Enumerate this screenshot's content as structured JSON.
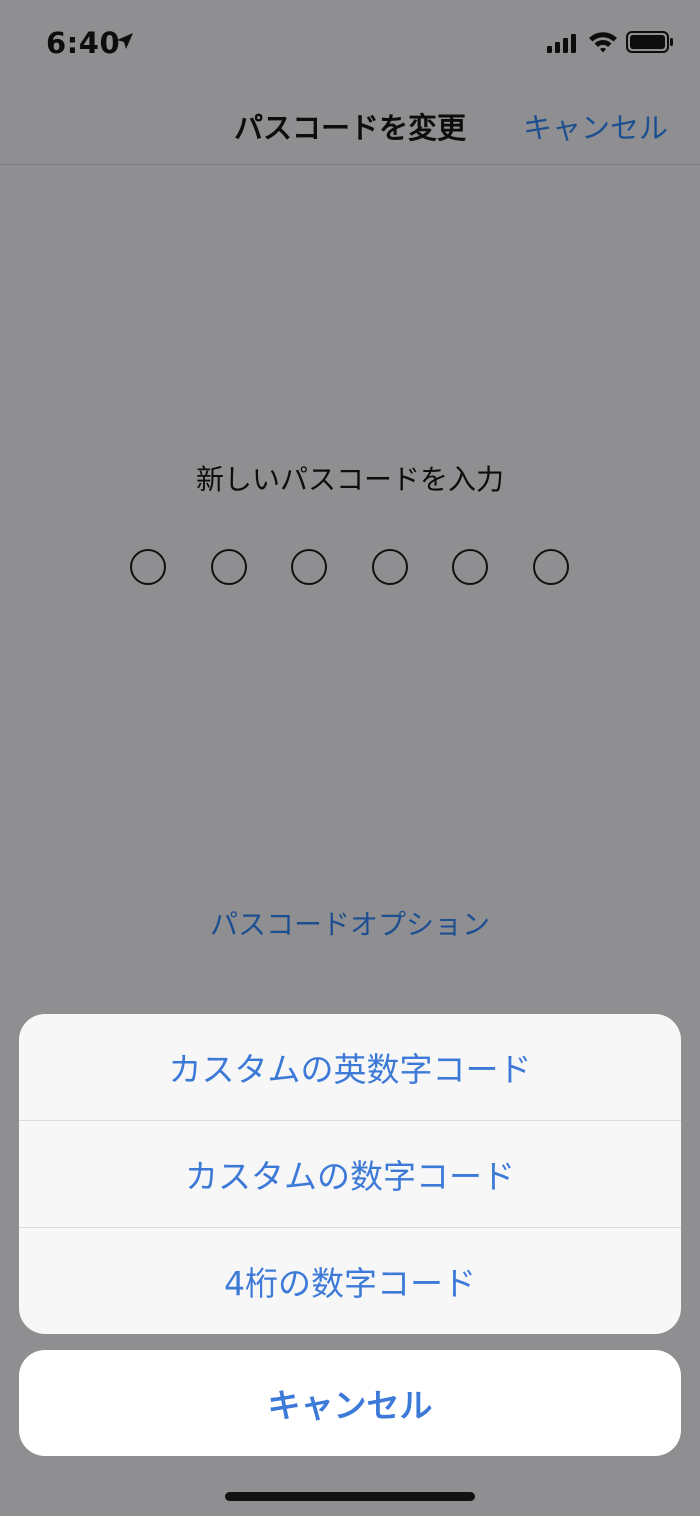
{
  "status_bar": {
    "time": "6:40",
    "icons": [
      "location-arrow-icon",
      "signal-icon",
      "wifi-icon",
      "battery-icon"
    ]
  },
  "nav": {
    "title": "パスコードを変更",
    "cancel_label": "キャンセル"
  },
  "passcode": {
    "prompt": "新しいパスコードを入力",
    "digit_count": 6,
    "filled_count": 0,
    "options_link": "パスコードオプション"
  },
  "action_sheet": {
    "options": [
      {
        "label": "カスタムの英数字コード"
      },
      {
        "label": "カスタムの数字コード"
      },
      {
        "label": "4桁の数字コード"
      }
    ],
    "cancel_label": "キャンセル"
  },
  "colors": {
    "accent": "#3d7ad8",
    "dimmed_accent": "#1c4f91",
    "dim_background": "#8f8f91",
    "sheet_background": "#f7f7f7"
  }
}
